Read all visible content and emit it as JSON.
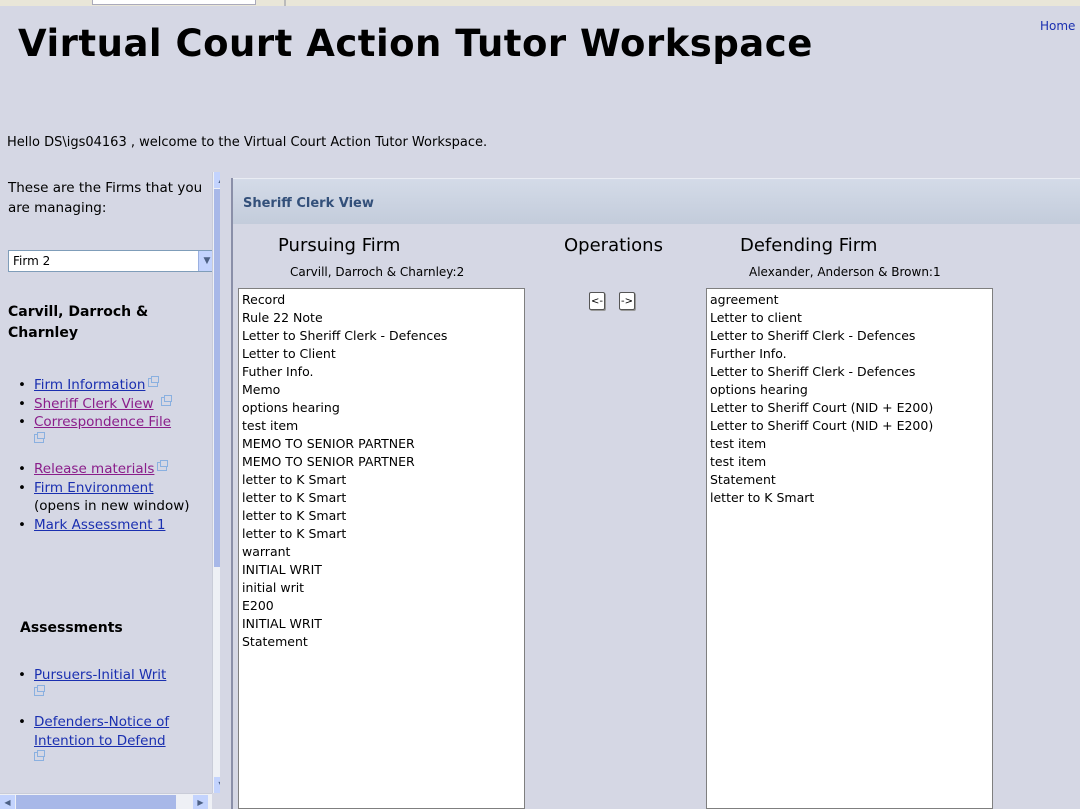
{
  "page": {
    "title": "Virtual Court Action Tutor Workspace",
    "home_link": "Home",
    "welcome": "Hello DS\\igs04163 , welcome to the Virtual Court Action Tutor Workspace."
  },
  "sidebar": {
    "firms_intro": "These are the Firms that you are managing:",
    "firm_select": {
      "value": "Firm 2"
    },
    "firm_name": "Carvill, Darroch & Charnley",
    "nav_items": [
      {
        "label": "Firm Information"
      },
      {
        "label": "Sheriff Clerk View"
      },
      {
        "label": "Correspondence File"
      },
      {
        "label": "Release materials"
      },
      {
        "label": "Firm Environment",
        "note": "(opens in new window)"
      },
      {
        "label": "Mark Assessment 1"
      }
    ],
    "assessments_heading": "Assessments",
    "assessments": [
      {
        "label": "Pursuers-Initial Writ"
      },
      {
        "label": "Defenders-Notice of Intention to Defend"
      }
    ]
  },
  "panel": {
    "title": "Sheriff Clerk View",
    "pursuing": {
      "heading": "Pursuing Firm",
      "firm": "Carvill, Darroch & Charnley:2",
      "items": [
        "Record",
        "Rule 22 Note",
        "Letter to Sheriff Clerk - Defences",
        "Letter to Client",
        "Futher Info.",
        "Memo",
        "options hearing",
        "test item",
        "MEMO TO SENIOR PARTNER",
        "MEMO TO SENIOR PARTNER",
        "letter to K Smart",
        "letter to K Smart",
        "letter to K Smart",
        "letter to K Smart",
        "warrant",
        "INITIAL WRIT",
        "initial writ",
        "E200",
        "INITIAL WRIT",
        "Statement"
      ]
    },
    "operations": {
      "heading": "Operations",
      "move_left": "<-",
      "move_right": "->"
    },
    "defending": {
      "heading": "Defending Firm",
      "firm": "Alexander, Anderson & Brown:1",
      "items": [
        "agreement",
        "Letter to client",
        "Letter to Sheriff Clerk - Defences",
        "Further Info.",
        "Letter to Sheriff Clerk - Defences",
        "options hearing",
        "Letter to Sheriff Court (NID + E200)",
        "Letter to Sheriff Court (NID + E200)",
        "test item",
        "test item",
        "Statement",
        "letter to K Smart"
      ]
    }
  }
}
